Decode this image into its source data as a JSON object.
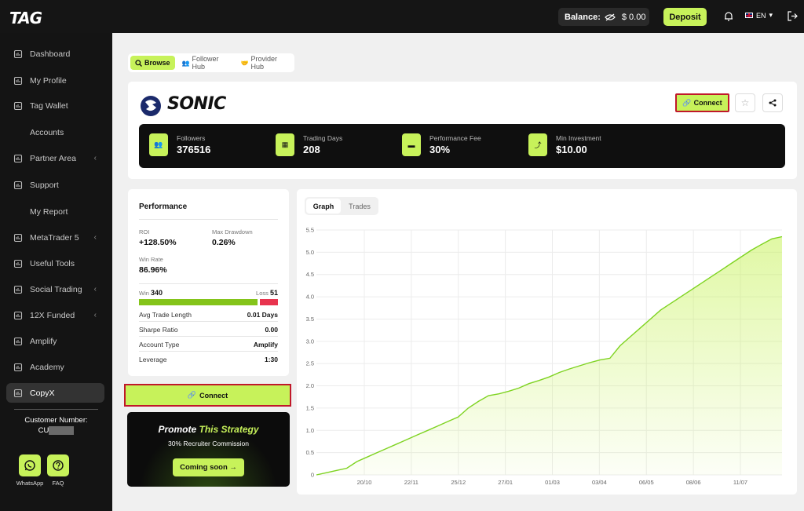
{
  "header": {
    "logo": "TAG",
    "balance_label": "Balance:",
    "balance_value": "$ 0.00",
    "deposit_label": "Deposit",
    "language": "EN"
  },
  "sidebar": {
    "items": [
      {
        "label": "Dashboard",
        "icon": "dashboard-icon"
      },
      {
        "label": "My Profile",
        "icon": "user-icon"
      },
      {
        "label": "Tag Wallet",
        "icon": "wallet-icon"
      },
      {
        "label": "Accounts",
        "icon": ""
      },
      {
        "label": "Partner Area",
        "icon": "network-icon",
        "chevron": true
      },
      {
        "label": "Support",
        "icon": "support-icon"
      },
      {
        "label": "My Report",
        "icon": ""
      },
      {
        "label": "MetaTrader 5",
        "icon": "laptop-icon",
        "chevron": true
      },
      {
        "label": "Useful Tools",
        "icon": "tools-icon"
      },
      {
        "label": "Social Trading",
        "icon": "copy-icon",
        "chevron": true
      },
      {
        "label": "12X Funded",
        "icon": "bars-icon",
        "chevron": true
      },
      {
        "label": "Amplify",
        "icon": "bars-icon"
      },
      {
        "label": "Academy",
        "icon": "bars-icon"
      },
      {
        "label": "CopyX",
        "icon": "bars-icon",
        "active": true
      }
    ],
    "customer_label": "Customer Number:",
    "customer_prefix": "CU",
    "whatsapp_label": "WhatsApp",
    "faq_label": "FAQ"
  },
  "tabs": {
    "browse": "Browse",
    "follower_hub": "Follower Hub",
    "provider_hub": "Provider Hub"
  },
  "strategy": {
    "name": "SONIC",
    "connect_label": "Connect",
    "stats": [
      {
        "label": "Followers",
        "value": "376516",
        "icon": "users-icon"
      },
      {
        "label": "Trading Days",
        "value": "208",
        "icon": "calendar-icon"
      },
      {
        "label": "Performance Fee",
        "value": "30%",
        "icon": "fee-icon"
      },
      {
        "label": "Min Investment",
        "value": "$10.00",
        "icon": "invest-icon"
      }
    ]
  },
  "performance": {
    "title": "Performance",
    "roi_label": "ROI",
    "roi_value": "+128.50%",
    "drawdown_label": "Max Drawdown",
    "drawdown_value": "0.26%",
    "winrate_label": "Win Rate",
    "winrate_value": "86.96%",
    "win_label": "Win",
    "win_value": "340",
    "loss_label": "Loss",
    "loss_value": "51",
    "rows": [
      {
        "label": "Avg Trade Length",
        "value": "0.01 Days"
      },
      {
        "label": "Sharpe Ratio",
        "value": "0.00"
      },
      {
        "label": "Account Type",
        "value": "Amplify"
      },
      {
        "label": "Leverage",
        "value": "1:30"
      }
    ]
  },
  "connect_button": "Connect",
  "promo": {
    "title_a": "Promote ",
    "title_b": "This Strategy",
    "subtitle": "30% Recruiter Commission",
    "button": "Coming soon →"
  },
  "graph_tabs": {
    "graph": "Graph",
    "trades": "Trades"
  },
  "chart_data": {
    "type": "area",
    "x_ticks": [
      "20/10",
      "22/11",
      "25/12",
      "27/01",
      "01/03",
      "03/04",
      "06/05",
      "08/06",
      "11/07"
    ],
    "y_ticks": [
      "0",
      "0.5",
      "1.0",
      "1.5",
      "2.0",
      "2.5",
      "3.0",
      "3.5",
      "4.0",
      "4.5",
      "5.0",
      "5.5"
    ],
    "ylim": [
      0,
      5.5
    ],
    "grid": true,
    "color": "#7ed321",
    "series": [
      {
        "values": [
          0,
          0.05,
          0.1,
          0.15,
          0.3,
          0.4,
          0.5,
          0.6,
          0.7,
          0.8,
          0.9,
          1.0,
          1.1,
          1.2,
          1.3,
          1.5,
          1.65,
          1.78,
          1.82,
          1.88,
          1.95,
          2.05,
          2.12,
          2.2,
          2.3,
          2.38,
          2.45,
          2.52,
          2.58,
          2.62,
          2.9,
          3.1,
          3.3,
          3.5,
          3.7,
          3.85,
          4.0,
          4.15,
          4.3,
          4.45,
          4.6,
          4.75,
          4.9,
          5.05,
          5.18,
          5.3,
          5.35
        ]
      }
    ]
  }
}
